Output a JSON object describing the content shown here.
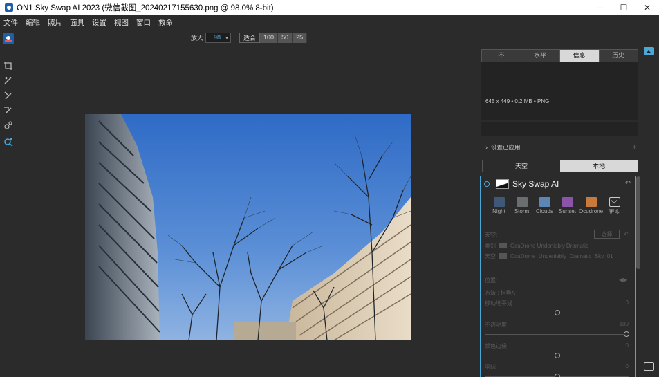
{
  "window": {
    "title": "ON1 Sky Swap AI 2023 (微信截图_20240217155630.png @ 98.0% 8-bit)",
    "controls": [
      "─",
      "☐",
      "✕"
    ]
  },
  "menu": [
    "文件",
    "编辑",
    "照片",
    "面具",
    "设置",
    "视图",
    "窗口",
    "救命"
  ],
  "zoom": {
    "label": "放大",
    "value": "98",
    "dropdown": "▾",
    "buttons": [
      "适合",
      "100",
      "50",
      "25"
    ]
  },
  "panel": {
    "tabs": [
      "不",
      "水平",
      "信息",
      "历史"
    ],
    "active_tab": 2,
    "info_text": "645 x 449 • 0.2 MB • PNG",
    "applied_label": "设置已应用",
    "sub_tabs": [
      "天空",
      "本地"
    ],
    "active_sub_tab": 1
  },
  "module": {
    "title": "Sky Swap AI",
    "presets": [
      {
        "label": "Night",
        "color": "#3f5877"
      },
      {
        "label": "Storm",
        "color": "#6a6e6e"
      },
      {
        "label": "Clouds",
        "color": "#5e86b4"
      },
      {
        "label": "Sunset",
        "color": "#8a55a8"
      },
      {
        "label": "Ocudrone",
        "color": "#c87a3c"
      },
      {
        "label": "更多",
        "color": "more"
      }
    ],
    "sky_label": "天空:",
    "select_label": "选择",
    "category_label": "类别",
    "category_value": "OcuDrone Undeniably Dramatic",
    "sky_row_label": "天空",
    "sky_value": "OcuDrone_Undeniably_Dramatic_Sky_01",
    "position_label": "位置:",
    "method_label": "方法 : 指导A",
    "horizon_label": "移动地平线",
    "horizon_value": "0",
    "opacity_label": "不透明度",
    "opacity_value": "100",
    "color_edge_label": "颜色边缘",
    "color_edge_value": "0",
    "blend_label": "羽绒",
    "blend_value": "0"
  }
}
